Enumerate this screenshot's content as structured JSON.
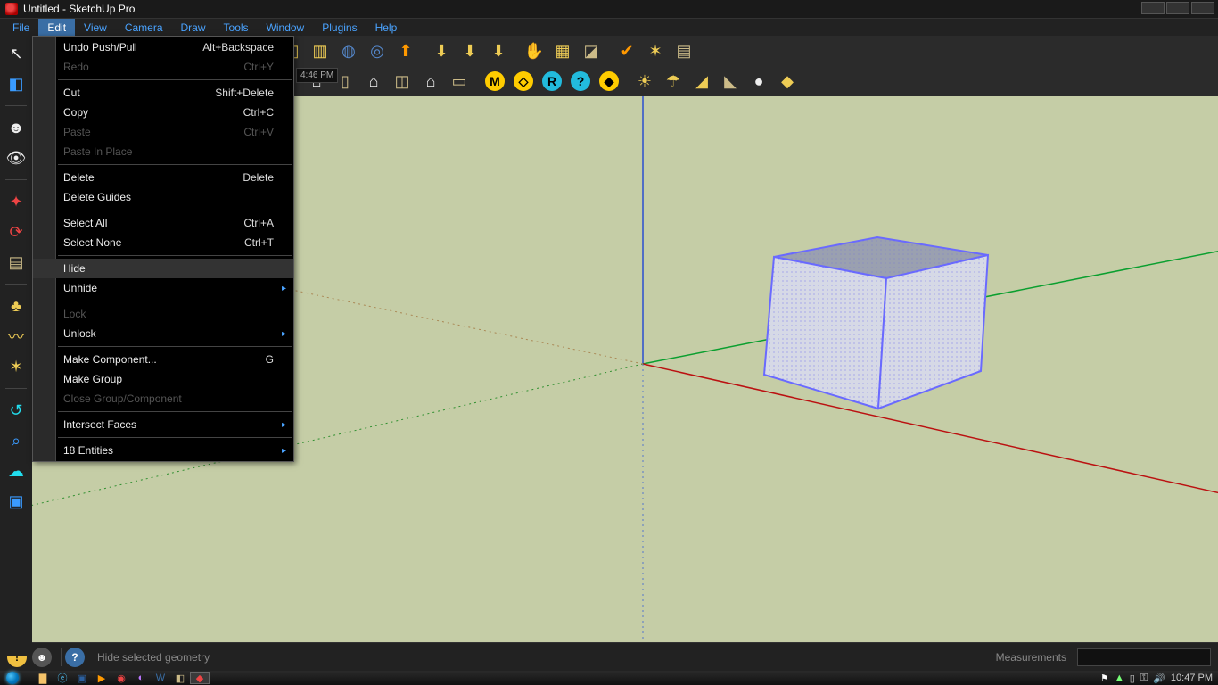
{
  "titlebar": {
    "text": "Untitled - SketchUp Pro"
  },
  "menubar": {
    "items": [
      "File",
      "Edit",
      "View",
      "Camera",
      "Draw",
      "Tools",
      "Window",
      "Plugins",
      "Help"
    ],
    "active": "Edit"
  },
  "edit_menu": {
    "items": [
      {
        "label": "Undo Push/Pull",
        "shortcut": "Alt+Backspace",
        "enabled": true
      },
      {
        "label": "Redo",
        "shortcut": "Ctrl+Y",
        "enabled": false
      },
      {
        "sep": true
      },
      {
        "label": "Cut",
        "shortcut": "Shift+Delete",
        "enabled": true
      },
      {
        "label": "Copy",
        "shortcut": "Ctrl+C",
        "enabled": true
      },
      {
        "label": "Paste",
        "shortcut": "Ctrl+V",
        "enabled": false
      },
      {
        "label": "Paste In Place",
        "shortcut": "",
        "enabled": false
      },
      {
        "sep": true
      },
      {
        "label": "Delete",
        "shortcut": "Delete",
        "enabled": true
      },
      {
        "label": "Delete Guides",
        "shortcut": "",
        "enabled": true
      },
      {
        "sep": true
      },
      {
        "label": "Select All",
        "shortcut": "Ctrl+A",
        "enabled": true
      },
      {
        "label": "Select None",
        "shortcut": "Ctrl+T",
        "enabled": true
      },
      {
        "sep": true
      },
      {
        "label": "Hide",
        "shortcut": "",
        "enabled": true,
        "highlight": true
      },
      {
        "label": "Unhide",
        "shortcut": "",
        "enabled": true,
        "sub": true
      },
      {
        "sep": true
      },
      {
        "label": "Lock",
        "shortcut": "",
        "enabled": false
      },
      {
        "label": "Unlock",
        "shortcut": "",
        "enabled": true,
        "sub": true
      },
      {
        "sep": true
      },
      {
        "label": "Make Component...",
        "shortcut": "G",
        "enabled": true
      },
      {
        "label": "Make Group",
        "shortcut": "",
        "enabled": true
      },
      {
        "label": "Close Group/Component",
        "shortcut": "",
        "enabled": false
      },
      {
        "sep": true
      },
      {
        "label": "Intersect Faces",
        "shortcut": "",
        "enabled": true,
        "sub": true
      },
      {
        "sep": true
      },
      {
        "label": "18 Entities",
        "shortcut": "",
        "enabled": true,
        "sub": true
      }
    ]
  },
  "toolbar_badge_time": "4:46 PM",
  "statusbar": {
    "help_text": "Hide selected geometry",
    "measurements_label": "Measurements"
  },
  "tray": {
    "clock": "10:47 PM"
  },
  "icons": {
    "left": [
      {
        "g": "↖",
        "c": "i-white",
        "n": "select-tool"
      },
      {
        "g": "◧",
        "c": "i-blue",
        "n": "component-tool"
      },
      {
        "g": "",
        "c": "",
        "n": "sep"
      },
      {
        "g": "☻",
        "c": "i-white",
        "n": "figure-tool"
      },
      {
        "g": "👁",
        "c": "i-white",
        "n": "eye-tool"
      },
      {
        "g": "",
        "c": "",
        "n": "sep"
      },
      {
        "g": "✦",
        "c": "i-red",
        "n": "plugin-red"
      },
      {
        "g": "⟳",
        "c": "i-red",
        "n": "plugin-reload"
      },
      {
        "g": "▤",
        "c": "i-br",
        "n": "plugin-image"
      },
      {
        "g": "",
        "c": "",
        "n": "sep"
      },
      {
        "g": "♣",
        "c": "i-gold",
        "n": "plugin-tree"
      },
      {
        "g": "〰",
        "c": "i-gold",
        "n": "plugin-curve"
      },
      {
        "g": "✶",
        "c": "i-gold",
        "n": "plugin-star"
      },
      {
        "g": "",
        "c": "",
        "n": "sep"
      },
      {
        "g": "↺",
        "c": "i-cyan",
        "n": "plugin-rotate"
      },
      {
        "g": "⌕",
        "c": "i-blue",
        "n": "plugin-search"
      },
      {
        "g": "☁",
        "c": "i-cyan",
        "n": "plugin-cloud"
      },
      {
        "g": "▣",
        "c": "i-blue",
        "n": "plugin-misc"
      }
    ],
    "row1": [
      {
        "g": "✦",
        "c": "i-red",
        "n": "star1"
      },
      {
        "g": "↻",
        "c": "i-orange",
        "n": "orbit1"
      },
      {
        "g": "↯",
        "c": "i-br",
        "n": "zig"
      },
      {
        "g": "",
        "c": "",
        "n": "sep"
      },
      {
        "g": "⊕",
        "c": "i-blue",
        "n": "zoom-ex"
      },
      {
        "g": "✋",
        "c": "i-white",
        "n": "pan"
      },
      {
        "g": "⌕",
        "c": "i-white",
        "n": "zoom"
      },
      {
        "g": "⛶",
        "c": "i-white",
        "n": "zoom-win"
      },
      {
        "g": "",
        "c": "",
        "n": "sep"
      },
      {
        "g": "▭",
        "c": "i-gold",
        "n": "box1"
      },
      {
        "g": "◫",
        "c": "i-gold",
        "n": "box2"
      },
      {
        "g": "▥",
        "c": "i-gold",
        "n": "box3"
      },
      {
        "g": "◍",
        "c": "i-nav",
        "n": "globe1"
      },
      {
        "g": "◎",
        "c": "i-nav",
        "n": "globe2"
      },
      {
        "g": "⬆",
        "c": "i-orange",
        "n": "up-arrow"
      },
      {
        "g": "",
        "c": "",
        "n": "sep"
      },
      {
        "g": "⬇",
        "c": "i-gold",
        "n": "dl1"
      },
      {
        "g": "⬇",
        "c": "i-gold",
        "n": "dl2"
      },
      {
        "g": "⬇",
        "c": "i-gold",
        "n": "dl3"
      },
      {
        "g": "",
        "c": "",
        "n": "sep"
      },
      {
        "g": "✋",
        "c": "i-br",
        "n": "hand2"
      },
      {
        "g": "▦",
        "c": "i-gold",
        "n": "grid"
      },
      {
        "g": "◪",
        "c": "i-br",
        "n": "frame"
      },
      {
        "g": "",
        "c": "",
        "n": "sep"
      },
      {
        "g": "✔",
        "c": "i-orange",
        "n": "check"
      },
      {
        "g": "✶",
        "c": "i-gold",
        "n": "spark"
      },
      {
        "g": "▤",
        "c": "i-br",
        "n": "cal"
      }
    ],
    "row2": [
      {
        "g": "⌂",
        "c": "i-white",
        "n": "home1"
      },
      {
        "g": "▯",
        "c": "i-br",
        "n": "door"
      },
      {
        "g": "⌂",
        "c": "i-white",
        "n": "home2"
      },
      {
        "g": "◫",
        "c": "i-br",
        "n": "win"
      },
      {
        "g": "⌂",
        "c": "i-white",
        "n": "home3"
      },
      {
        "g": "▭",
        "c": "i-br",
        "n": "slab"
      },
      {
        "g": "",
        "c": "",
        "n": "sep"
      },
      {
        "t": "circ",
        "g": "M",
        "bg": "#fc0",
        "n": "m-btn"
      },
      {
        "t": "circ",
        "g": "◇",
        "bg": "#fc0",
        "n": "d-btn"
      },
      {
        "t": "circ",
        "g": "R",
        "bg": "#2bd",
        "n": "r-btn"
      },
      {
        "t": "circ",
        "g": "?",
        "bg": "#2bd",
        "n": "q-btn"
      },
      {
        "t": "circ",
        "g": "◆",
        "bg": "#fc0",
        "n": "diamond-btn"
      },
      {
        "g": "",
        "c": "",
        "n": "sep"
      },
      {
        "g": "☀",
        "c": "i-gold",
        "n": "sun1"
      },
      {
        "g": "☂",
        "c": "i-gold",
        "n": "shade1"
      },
      {
        "g": "◢",
        "c": "i-gold",
        "n": "shade2"
      },
      {
        "g": "◣",
        "c": "i-br",
        "n": "shade3"
      },
      {
        "g": "●",
        "c": "i-white",
        "n": "ball"
      },
      {
        "g": "◆",
        "c": "i-gold",
        "n": "dia2"
      }
    ]
  }
}
